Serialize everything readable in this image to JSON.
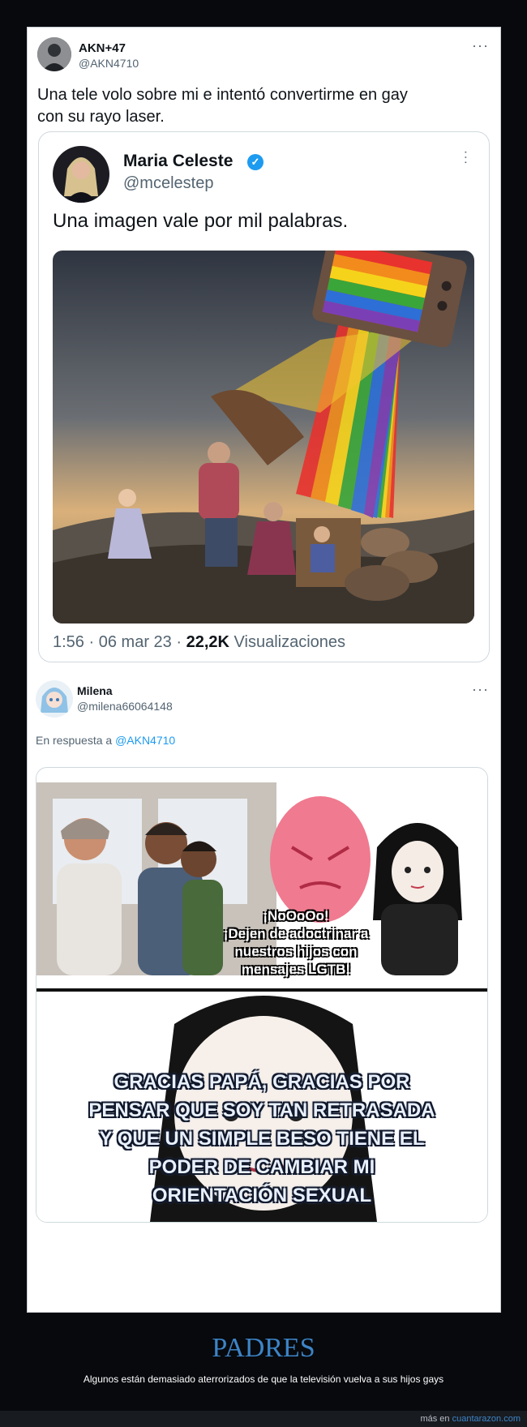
{
  "tweet": {
    "display_name": "AKN+47",
    "handle": "@AKN4710",
    "text_line1": "Una tele volo sobre mi e intentó convertirme en gay",
    "text_line2": "con su rayo laser.",
    "more_icon": "more-dots-icon"
  },
  "quoted_tweet": {
    "display_name": "Maria Celeste",
    "handle": "@mcelestep",
    "verified_icon": "verified-badge-icon",
    "text": "Una imagen vale por mil palabras.",
    "time": "1:56",
    "sep1": "·",
    "date": "06 mar 23",
    "sep2": "·",
    "views_count": "22,2K",
    "views_label": "Visualizaciones"
  },
  "reply": {
    "display_name": "Milena",
    "handle": "@milena66064148",
    "in_reply_prefix": "En respuesta a",
    "in_reply_handle": "@AKN4710",
    "meme_top_line1": "¡NoOoOo!",
    "meme_top_line2": "¡Dejen de adoctrinar a",
    "meme_top_line3": "nuestros hijos con",
    "meme_top_line4": "mensajes LGTB!",
    "meme_bottom_line1": "GRACIAS PAPÁ, GRACIAS POR",
    "meme_bottom_line2": "PENSAR QUE SOY TAN RETRASADA",
    "meme_bottom_line3": "Y QUE UN SIMPLE BESO TIENE EL",
    "meme_bottom_line4": "PODER DE CAMBIAR MI",
    "meme_bottom_line5": "ORIENTACIÓN SEXUAL"
  },
  "footer": {
    "title": "PADRES",
    "description": "Algunos están demasiado aterrorizados de que la televisión vuelva a sus hijos gays",
    "link_prefix": "más en",
    "link_site": "cuantarazon.com"
  },
  "colors": {
    "page_bg": "#07090d",
    "link_blue": "#1d9bf0",
    "footer_title": "#3d84c6",
    "meme_pink": "#f07a8f"
  }
}
